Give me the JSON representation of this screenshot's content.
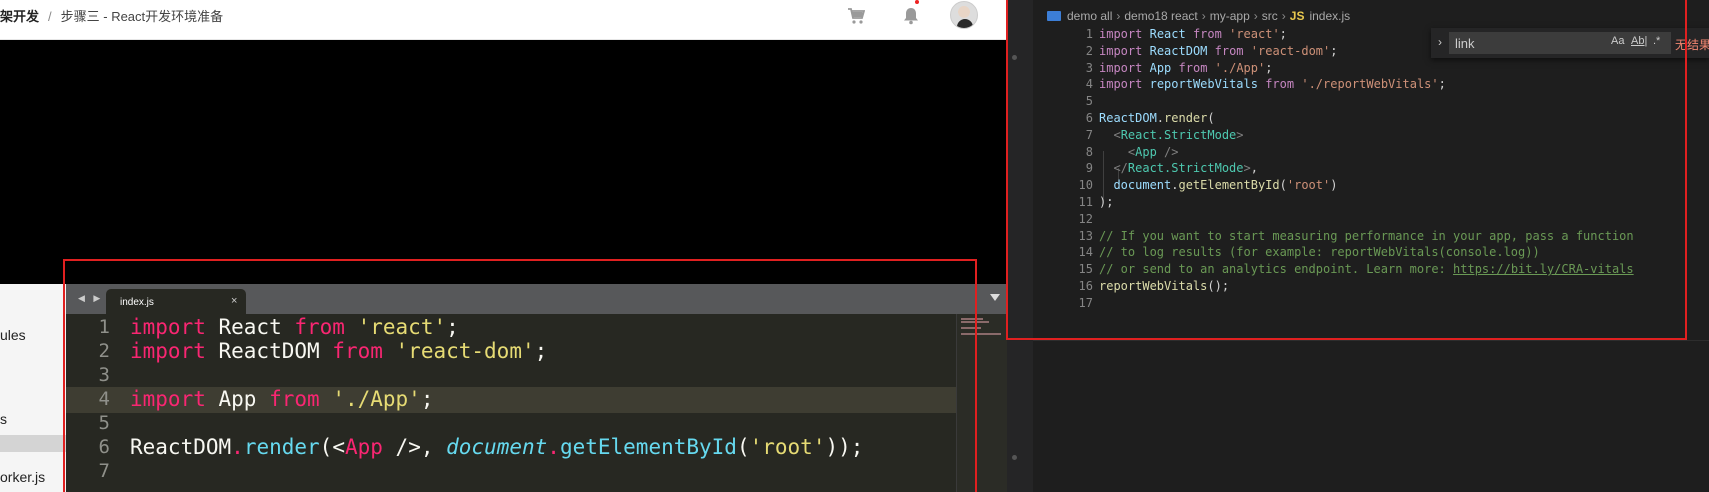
{
  "course": {
    "breadcrumb": {
      "course": "架开发",
      "separator": "/",
      "lesson": "步骤三 - React开发环境准备"
    },
    "icons": {
      "cart": "shopping-cart-icon",
      "bell": "notification-bell-icon"
    },
    "sidebar": {
      "items": [
        "ules",
        "s",
        "orker.js"
      ]
    }
  },
  "sublime": {
    "tab_label": "index.js",
    "tab_close": "×",
    "line_numbers": [
      "1",
      "2",
      "3",
      "4",
      "5",
      "6",
      "7"
    ],
    "lines": [
      [
        {
          "t": "import",
          "c": "kw"
        },
        {
          "t": " React "
        },
        {
          "t": "from",
          "c": "kw"
        },
        {
          "t": " "
        },
        {
          "t": "'react'",
          "c": "str"
        },
        {
          "t": ";"
        }
      ],
      [
        {
          "t": "import",
          "c": "kw"
        },
        {
          "t": " ReactDOM "
        },
        {
          "t": "from",
          "c": "kw"
        },
        {
          "t": " "
        },
        {
          "t": "'react-dom'",
          "c": "str"
        },
        {
          "t": ";"
        }
      ],
      [],
      [
        {
          "t": "import",
          "c": "kw"
        },
        {
          "t": " App "
        },
        {
          "t": "from",
          "c": "kw"
        },
        {
          "t": " "
        },
        {
          "t": "'./App'",
          "c": "str"
        },
        {
          "t": ";"
        }
      ],
      [],
      [
        {
          "t": "ReactDOM"
        },
        {
          "t": ".",
          "c": "kw"
        },
        {
          "t": "render",
          "c": "fn"
        },
        {
          "t": "(<"
        },
        {
          "t": "App",
          "c": "tag"
        },
        {
          "t": " />, "
        },
        {
          "t": "document",
          "c": "it"
        },
        {
          "t": ".",
          "c": "kw"
        },
        {
          "t": "getElementById",
          "c": "fn"
        },
        {
          "t": "("
        },
        {
          "t": "'root'",
          "c": "str"
        },
        {
          "t": "));"
        }
      ],
      []
    ]
  },
  "vscode": {
    "breadcrumb": [
      "demo all",
      "demo18 react",
      "my-app",
      "src"
    ],
    "breadcrumb_file_lang": "JS",
    "breadcrumb_file": "index.js",
    "find": {
      "value": "link",
      "match_case": "Aa",
      "whole_word": "Ab|",
      "regex": ".*",
      "result": "无结果"
    },
    "line_numbers": [
      "1",
      "2",
      "3",
      "4",
      "5",
      "6",
      "7",
      "8",
      "9",
      "10",
      "11",
      "12",
      "13",
      "14",
      "15",
      "16",
      "17"
    ],
    "lines": [
      [
        {
          "t": "import",
          "c": "v-ctrl"
        },
        {
          "t": " "
        },
        {
          "t": "React",
          "c": "v-var"
        },
        {
          "t": " "
        },
        {
          "t": "from",
          "c": "v-ctrl"
        },
        {
          "t": " "
        },
        {
          "t": "'react'",
          "c": "v-str"
        },
        {
          "t": ";"
        }
      ],
      [
        {
          "t": "import",
          "c": "v-ctrl"
        },
        {
          "t": " "
        },
        {
          "t": "ReactDOM",
          "c": "v-var"
        },
        {
          "t": " "
        },
        {
          "t": "from",
          "c": "v-ctrl"
        },
        {
          "t": " "
        },
        {
          "t": "'react-dom'",
          "c": "v-str"
        },
        {
          "t": ";"
        }
      ],
      [
        {
          "t": "import",
          "c": "v-ctrl"
        },
        {
          "t": " "
        },
        {
          "t": "App",
          "c": "v-var"
        },
        {
          "t": " "
        },
        {
          "t": "from",
          "c": "v-ctrl"
        },
        {
          "t": " "
        },
        {
          "t": "'./App'",
          "c": "v-str"
        },
        {
          "t": ";"
        }
      ],
      [
        {
          "t": "import",
          "c": "v-ctrl"
        },
        {
          "t": " "
        },
        {
          "t": "reportWebVitals",
          "c": "v-var"
        },
        {
          "t": " "
        },
        {
          "t": "from",
          "c": "v-ctrl"
        },
        {
          "t": " "
        },
        {
          "t": "'./reportWebVitals'",
          "c": "v-str"
        },
        {
          "t": ";"
        }
      ],
      [],
      [
        {
          "t": "ReactDOM",
          "c": "v-var"
        },
        {
          "t": "."
        },
        {
          "t": "render",
          "c": "v-fn"
        },
        {
          "t": "("
        }
      ],
      [
        {
          "t": "  "
        },
        {
          "t": "<",
          "c": "v-pun"
        },
        {
          "t": "React.StrictMode",
          "c": "v-tag"
        },
        {
          "t": ">",
          "c": "v-pun"
        }
      ],
      [
        {
          "t": "    "
        },
        {
          "t": "<",
          "c": "v-pun"
        },
        {
          "t": "App",
          "c": "v-tag"
        },
        {
          "t": " />",
          "c": "v-pun"
        }
      ],
      [
        {
          "t": "  "
        },
        {
          "t": "</",
          "c": "v-pun"
        },
        {
          "t": "React.StrictMode",
          "c": "v-tag"
        },
        {
          "t": ">",
          "c": "v-pun"
        },
        {
          "t": ","
        }
      ],
      [
        {
          "t": "  "
        },
        {
          "t": "document",
          "c": "v-var"
        },
        {
          "t": "."
        },
        {
          "t": "getElementById",
          "c": "v-fn"
        },
        {
          "t": "("
        },
        {
          "t": "'root'",
          "c": "v-str"
        },
        {
          "t": ")"
        }
      ],
      [
        {
          "t": ");"
        }
      ],
      [],
      [
        {
          "t": "// If you want to start measuring performance in your app, pass a function",
          "c": "v-cm"
        }
      ],
      [
        {
          "t": "// to log results (for example: reportWebVitals(console.log))",
          "c": "v-cm"
        }
      ],
      [
        {
          "t": "// or send to an analytics endpoint. Learn more: ",
          "c": "v-cm"
        },
        {
          "t": "https://bit.ly/CRA-vitals",
          "c": "v-link"
        }
      ],
      [
        {
          "t": "reportWebVitals",
          "c": "v-fn"
        },
        {
          "t": "();"
        }
      ],
      []
    ]
  }
}
